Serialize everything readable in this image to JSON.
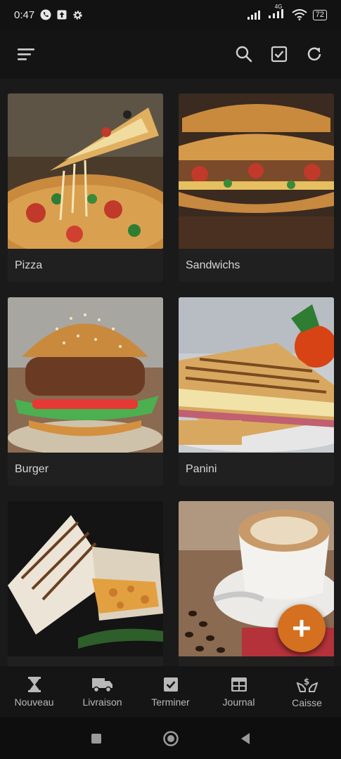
{
  "status": {
    "time": "0:47",
    "battery": "72",
    "network": "4G"
  },
  "toolbar": {
    "menu_icon": "hamburger-icon",
    "search_icon": "search-icon",
    "check_icon": "checkbox-icon",
    "refresh_icon": "refresh-icon"
  },
  "categories": [
    {
      "label": "Pizza",
      "icon": "pizza-photo"
    },
    {
      "label": "Sandwichs",
      "icon": "sandwich-photo"
    },
    {
      "label": "Burger",
      "icon": "burger-photo"
    },
    {
      "label": "Panini",
      "icon": "panini-photo"
    },
    {
      "label": "",
      "icon": "wrap-photo"
    },
    {
      "label": "",
      "icon": "coffee-photo"
    }
  ],
  "fab": {
    "icon": "plus-icon",
    "color": "#d4701f"
  },
  "nav": [
    {
      "label": "Nouveau",
      "icon": "hourglass-icon"
    },
    {
      "label": "Livraison",
      "icon": "truck-icon"
    },
    {
      "label": "Terminer",
      "icon": "checkbox-icon"
    },
    {
      "label": "Journal",
      "icon": "table-icon"
    },
    {
      "label": "Caisse",
      "icon": "cash-hands-icon"
    }
  ]
}
